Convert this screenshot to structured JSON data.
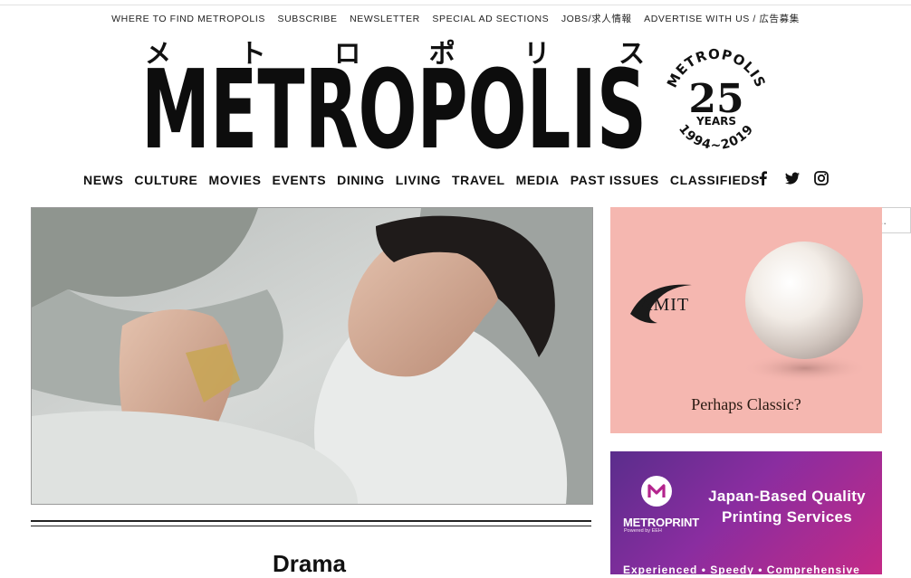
{
  "utility_nav": [
    "WHERE TO FIND METROPOLIS",
    "SUBSCRIBE",
    "NEWSLETTER",
    "SPECIAL AD SECTIONS",
    "JOBS/求人情報",
    "ADVERTISE WITH US / 広告募集"
  ],
  "masthead": {
    "kana": [
      "メ",
      "ト",
      "ロ",
      "ポ",
      "リ",
      "ス"
    ],
    "wordmark": "METROPOLIS",
    "badge": {
      "name": "METROPOLIS",
      "number": "25",
      "years": "YEARS",
      "range": "1994~2019"
    }
  },
  "main_nav": [
    "NEWS",
    "CULTURE",
    "MOVIES",
    "EVENTS",
    "DINING",
    "LIVING",
    "TRAVEL",
    "MEDIA",
    "PAST ISSUES",
    "CLASSIFIEDS"
  ],
  "social": [
    "facebook-icon",
    "twitter-icon",
    "instagram-icon"
  ],
  "search": {
    "placeholder": "Search..."
  },
  "article": {
    "category": "Drama"
  },
  "ads": {
    "pearl": {
      "brand": "AMIT",
      "tagline": "Perhaps Classic?"
    },
    "print": {
      "brand": "METROPRINT",
      "brand_sub": "Powered by EEH",
      "headline_1": "Japan-Based Quality",
      "headline_2": "Printing Services",
      "tags": "Experienced  •  Speedy  •  Comprehensive"
    }
  },
  "colors": {
    "pearl_ad_bg": "#f5b7b0",
    "print_ad_purple": "#5a2d8c",
    "print_ad_pink": "#c42a86"
  }
}
